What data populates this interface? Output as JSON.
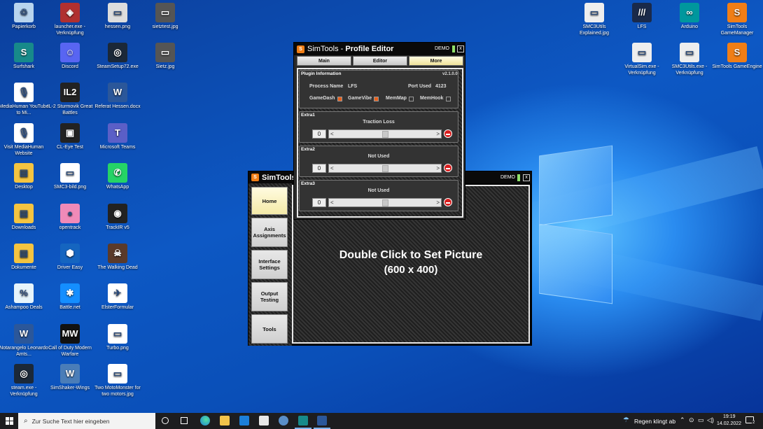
{
  "desktop_icons": [
    {
      "id": "papierkorb",
      "label": "Papierkorb",
      "icon": "recycle-bin-icon",
      "color": "#b8d4ee",
      "glyph": "♲"
    },
    {
      "id": "surfshark",
      "label": "Surfshark",
      "icon": "surfshark-icon",
      "color": "#178a8a",
      "glyph": "S"
    },
    {
      "id": "mediahuman",
      "label": "MediaHuman YouTube to Mi...",
      "icon": "microphone-icon",
      "color": "#ffffff",
      "glyph": "🎙"
    },
    {
      "id": "visit-mediahuman",
      "label": "Visit MediaHuman Website",
      "icon": "microphone-icon",
      "color": "#ffffff",
      "glyph": "🎙"
    },
    {
      "id": "desktop",
      "label": "Desktop",
      "icon": "folder-icon",
      "color": "#f4c441",
      "glyph": "▤"
    },
    {
      "id": "downloads",
      "label": "Downloads",
      "icon": "folder-icon",
      "color": "#f4c441",
      "glyph": "▤"
    },
    {
      "id": "dokumente",
      "label": "Dokumente",
      "icon": "folder-icon",
      "color": "#f4c441",
      "glyph": "▤"
    },
    {
      "id": "ashampoo",
      "label": "Ashampoo Deals",
      "icon": "shopping-cart-icon",
      "color": "#e6f4fb",
      "glyph": "%"
    },
    {
      "id": "notarangelo",
      "label": "Notarangelo Leonardo Amts...",
      "icon": "word-doc-icon",
      "color": "#2b579a",
      "glyph": "W"
    },
    {
      "id": "steam-exe",
      "label": "steam.exe - Verknüpfung",
      "icon": "steam-icon",
      "color": "#1b2838",
      "glyph": "◎"
    },
    {
      "id": "launcher",
      "label": "launcher.exe - Verknüpfung",
      "icon": "launcher-icon",
      "color": "#b03030",
      "glyph": "◈"
    },
    {
      "id": "discord",
      "label": "Discord",
      "icon": "discord-icon",
      "color": "#5865f2",
      "glyph": "☺"
    },
    {
      "id": "il2",
      "label": "IL-2 Sturmovik Great Battles",
      "icon": "il2-icon",
      "color": "#222222",
      "glyph": "IL2"
    },
    {
      "id": "cl-eye",
      "label": "CL-Eye Test",
      "icon": "camera-icon",
      "color": "#222222",
      "glyph": "▣"
    },
    {
      "id": "smc3-bild",
      "label": "SMC3-bild.png",
      "icon": "image-file-icon",
      "color": "#ffffff",
      "glyph": "▭"
    },
    {
      "id": "opentrack",
      "label": "opentrack",
      "icon": "opentrack-icon",
      "color": "#f08ab8",
      "glyph": "●"
    },
    {
      "id": "driver-easy",
      "label": "Driver Easy",
      "icon": "driver-easy-icon",
      "color": "#1565c0",
      "glyph": "⬢"
    },
    {
      "id": "battlenet",
      "label": "Battle.net",
      "icon": "battlenet-icon",
      "color": "#148eff",
      "glyph": "✱"
    },
    {
      "id": "cod",
      "label": "Call of Duty Modern Warfare",
      "icon": "cod-icon",
      "color": "#111111",
      "glyph": "MW"
    },
    {
      "id": "simshaker",
      "label": "SimShaker-Wings",
      "icon": "simshaker-icon",
      "color": "#4a7db8",
      "glyph": "W"
    },
    {
      "id": "hessen",
      "label": "hessen.png",
      "icon": "image-file-icon",
      "color": "#dddddd",
      "glyph": "▭"
    },
    {
      "id": "steamsetup",
      "label": "SteamSetup72.exe",
      "icon": "steam-icon",
      "color": "#1b2838",
      "glyph": "◎"
    },
    {
      "id": "referat",
      "label": "Referat Hessen.docx",
      "icon": "word-doc-icon",
      "color": "#2b579a",
      "glyph": "W"
    },
    {
      "id": "teams",
      "label": "Microsoft Teams",
      "icon": "teams-icon",
      "color": "#5b5fc7",
      "glyph": "T"
    },
    {
      "id": "whatsapp",
      "label": "WhatsApp",
      "icon": "whatsapp-icon",
      "color": "#25d366",
      "glyph": "✆"
    },
    {
      "id": "trackir",
      "label": "TrackIR v5",
      "icon": "trackir-icon",
      "color": "#222222",
      "glyph": "◉"
    },
    {
      "id": "walking-dead",
      "label": "The Walking Dead",
      "icon": "walking-dead-icon",
      "color": "#5a3a2a",
      "glyph": "☠"
    },
    {
      "id": "elster",
      "label": "ElsterFormular",
      "icon": "elster-icon",
      "color": "#ffffff",
      "glyph": "✈"
    },
    {
      "id": "turbo",
      "label": "Turbo.png",
      "icon": "image-file-icon",
      "color": "#ffffff",
      "glyph": "▭"
    },
    {
      "id": "two-moto",
      "label": "Two MotoMonster for two motors.jpg",
      "icon": "image-file-icon",
      "color": "#ffffff",
      "glyph": "▭"
    },
    {
      "id": "sietztest",
      "label": "sietztest.jpg",
      "icon": "image-file-icon",
      "color": "#555555",
      "glyph": "▭"
    },
    {
      "id": "sietz",
      "label": "Sietz.jpg",
      "icon": "image-file-icon",
      "color": "#555555",
      "glyph": "▭"
    },
    {
      "id": "smc3utils-explained",
      "label": "SMC3Utils Explained.jpg",
      "icon": "image-file-icon",
      "color": "#eeeeee",
      "glyph": "▭"
    },
    {
      "id": "lfs",
      "label": "LFS",
      "icon": "lfs-icon",
      "color": "#1a2a4a",
      "glyph": "///"
    },
    {
      "id": "arduino",
      "label": "Arduino",
      "icon": "arduino-icon",
      "color": "#00979d",
      "glyph": "∞"
    },
    {
      "id": "simtools-gm",
      "label": "SimTools GameManager",
      "icon": "simtools-icon",
      "color": "#f07e16",
      "glyph": "S"
    },
    {
      "id": "virtualsim",
      "label": "VirtualSim.exe - Verknüpfung",
      "icon": "window-app-icon",
      "color": "#eeeeee",
      "glyph": "▭"
    },
    {
      "id": "smc3utils",
      "label": "SMC3Utils.exe - Verknüpfung",
      "icon": "window-app-icon",
      "color": "#eeeeee",
      "glyph": "▭"
    },
    {
      "id": "simtools-ge",
      "label": "SimTools GameEngine",
      "icon": "simtools-icon",
      "color": "#f07e16",
      "glyph": "S"
    }
  ],
  "main_window": {
    "title": "SimTools",
    "demo": "DEMO",
    "close": "x",
    "sidebar": [
      {
        "label": "Home",
        "active": true
      },
      {
        "label": "Axis Assignments",
        "active": false
      },
      {
        "label": "Interface Settings",
        "active": false
      },
      {
        "label": "Output Testing",
        "active": false
      },
      {
        "label": "Tools",
        "active": false
      }
    ],
    "picture_line1": "Double Click to Set Picture",
    "picture_line2": "(600 x 400)"
  },
  "profile_editor": {
    "title_prefix": "SimTools - ",
    "title_bold": "Profile Editor",
    "demo": "DEMO",
    "close": "x",
    "tabs": [
      {
        "label": "Main",
        "active": false
      },
      {
        "label": "Editor",
        "active": false
      },
      {
        "label": "More",
        "active": true
      }
    ],
    "plugin": {
      "heading": "Plugin Information",
      "version": "v2.1.0.0",
      "process_label": "Process Name",
      "process_value": "LFS",
      "port_label": "Port Used",
      "port_value": "4123",
      "flags": [
        {
          "label": "GameDash",
          "checked": true
        },
        {
          "label": "GameVibe",
          "checked": true
        },
        {
          "label": "MemMap",
          "checked": false
        },
        {
          "label": "MemHook",
          "checked": false
        }
      ]
    },
    "extras": [
      {
        "heading": "Extra1",
        "title": "Traction Loss",
        "value": "0",
        "left": "<",
        "right": ">"
      },
      {
        "heading": "Extra2",
        "title": "Not Used",
        "value": "0",
        "left": "<",
        "right": ">"
      },
      {
        "heading": "Extra3",
        "title": "Not Used",
        "value": "0",
        "left": "<",
        "right": ">"
      }
    ]
  },
  "taskbar": {
    "search_placeholder": "Zur Suche Text hier eingeben",
    "weather": "Regen klingt ab",
    "time": "19:19",
    "date": "14.02.2022",
    "notification_count": "2"
  }
}
